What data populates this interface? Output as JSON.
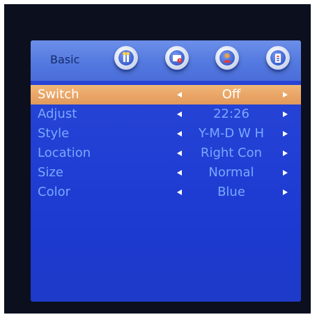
{
  "header": {
    "active_tab_label": "Basic",
    "tabs": [
      {
        "icon": "settings-tools-icon"
      },
      {
        "icon": "clock-icon"
      },
      {
        "icon": "user-icon"
      },
      {
        "icon": "info-icon"
      }
    ]
  },
  "menu": {
    "items": [
      {
        "label": "Switch",
        "value": "Off",
        "selected": true
      },
      {
        "label": "Adjust",
        "value": "22:26",
        "selected": false
      },
      {
        "label": "Style",
        "value": "Y-M-D W H",
        "selected": false
      },
      {
        "label": "Location",
        "value": "Right Con",
        "selected": false
      },
      {
        "label": "Size",
        "value": "Normal",
        "selected": false
      },
      {
        "label": "Color",
        "value": "Blue",
        "selected": false
      }
    ]
  },
  "colors": {
    "screen_bg": "#2240d4",
    "header_bg": "#5479e0",
    "selected_row": "#e9a466",
    "label_text": "#7aa8ff",
    "selected_text": "#ffffff"
  }
}
